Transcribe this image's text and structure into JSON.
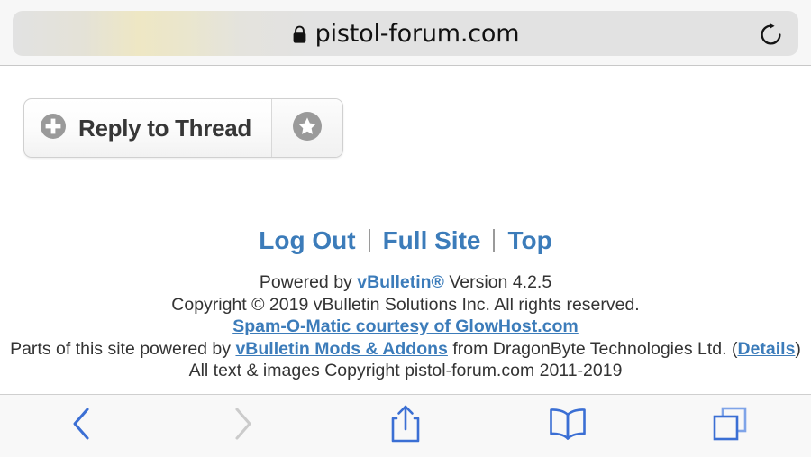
{
  "browser": {
    "url_bar": {
      "lock_icon": "lock-icon",
      "url": "pistol-forum.com",
      "secure": true
    },
    "reload_icon": "reload-icon",
    "bottom_toolbar": {
      "buttons": [
        {
          "name": "back-button",
          "icon": "chevron-left-icon",
          "enabled": true
        },
        {
          "name": "forward-button",
          "icon": "chevron-right-icon",
          "enabled": false
        },
        {
          "name": "share-button",
          "icon": "share-icon",
          "enabled": true
        },
        {
          "name": "bookmarks-button",
          "icon": "book-icon",
          "enabled": true
        },
        {
          "name": "tabs-button",
          "icon": "tabs-icon",
          "enabled": true
        }
      ]
    }
  },
  "page": {
    "reply_button": {
      "label": "Reply to Thread",
      "plus_icon": "plus-circle-icon"
    },
    "favorite_button": {
      "star_icon": "star-circle-icon"
    },
    "footer_nav": [
      {
        "label": "Log Out"
      },
      {
        "label": "Full Site"
      },
      {
        "label": "Top"
      }
    ],
    "footer_text": {
      "line1_prefix": "Powered by ",
      "line1_link": "vBulletin®",
      "line1_suffix": " Version 4.2.5",
      "line2": "Copyright © 2019 vBulletin Solutions Inc. All rights reserved.",
      "line3_link": "Spam-O-Matic courtesy of GlowHost.com",
      "line4_prefix": "Parts of this site powered by ",
      "line4_link": "vBulletin Mods & Addons",
      "line4_mid": " from DragonByte Technologies Ltd. (",
      "line4_link2": "Details",
      "line4_suffix": ")",
      "line5": "All text & images Copyright pistol-forum.com 2011-2019"
    }
  },
  "colors": {
    "link_blue": "#3c7cba",
    "toolbar_blue": "#4a7fe0",
    "toolbar_disabled": "#c9c9c9",
    "text_dark": "#333333"
  }
}
